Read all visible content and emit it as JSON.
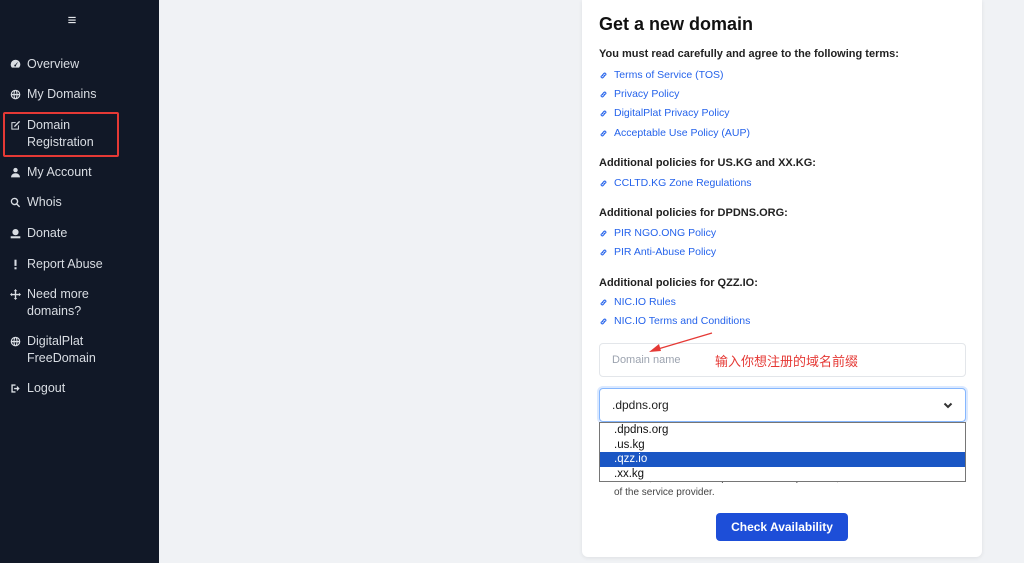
{
  "sidebar": {
    "menu_icon": "≡",
    "items": [
      {
        "label": "Overview",
        "icon": "gauge-icon"
      },
      {
        "label": "My Domains",
        "icon": "globe-icon"
      },
      {
        "label": "Domain Registration",
        "icon": "edit-icon"
      },
      {
        "label": "My Account",
        "icon": "user-icon"
      },
      {
        "label": "Whois",
        "icon": "search-icon"
      },
      {
        "label": "Donate",
        "icon": "donate-icon"
      },
      {
        "label": "Report Abuse",
        "icon": "exclamation-icon"
      },
      {
        "label": "Need more domains?",
        "icon": "arrows-icon"
      },
      {
        "label": "DigitalPlat FreeDomain",
        "icon": "globe-icon"
      },
      {
        "label": "Logout",
        "icon": "logout-icon"
      }
    ]
  },
  "card": {
    "title": "Get a new domain",
    "terms_heading": "You must read carefully and agree to the following terms:",
    "terms_links": [
      "Terms of Service (TOS)",
      "Privacy Policy",
      "DigitalPlat Privacy Policy",
      "Acceptable Use Policy (AUP)"
    ],
    "us_heading": "Additional policies for US.KG and XX.KG:",
    "us_links": [
      "CCLTD.KG Zone Regulations"
    ],
    "dpdns_heading": "Additional policies for DPDNS.ORG:",
    "dpdns_links": [
      "PIR NGO.ONG Policy",
      "PIR Anti-Abuse Policy"
    ],
    "qzz_heading": "Additional policies for QZZ.IO:",
    "qzz_links": [
      "NIC.IO Rules",
      "NIC.IO Terms and Conditions"
    ],
    "domain_placeholder": "Domain name",
    "annotation": "输入你想注册的域名前缀",
    "select_value": ".dpdns.org",
    "options": [
      ".dpdns.org",
      ".us.kg",
      ".qzz.io",
      ".xx.kg"
    ],
    "selected_option": ".qzz.io",
    "notice_line1": "account, with or without prior notice or explanation, at the sole discretion",
    "notice_line2": "of the service provider.",
    "check_button": "Check Availability"
  },
  "colors": {
    "sidebar_bg": "#111827",
    "link": "#2563eb",
    "button": "#1d4ed8",
    "annotation": "#e53935"
  }
}
